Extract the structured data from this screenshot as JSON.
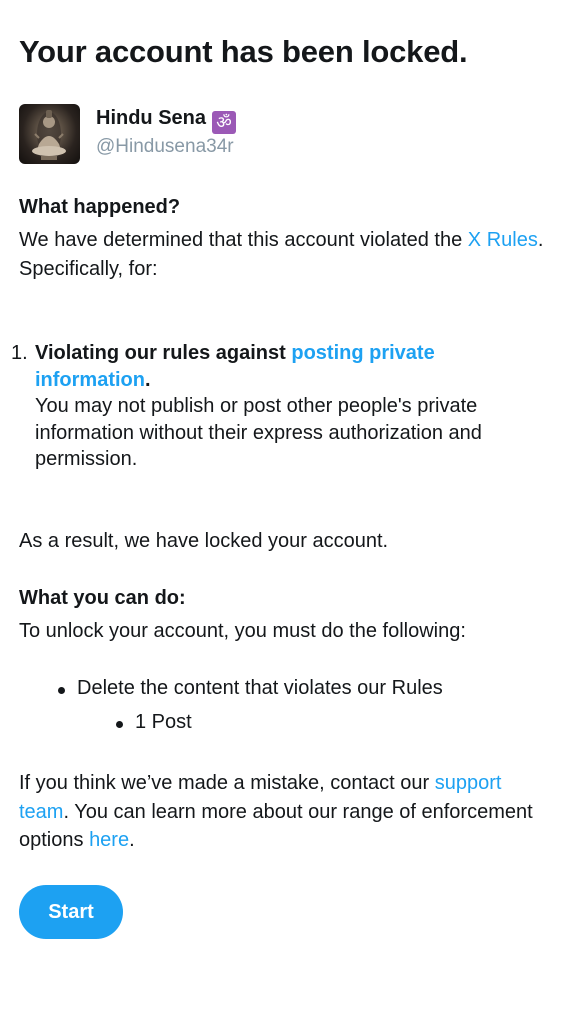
{
  "title": "Your account has been locked.",
  "account": {
    "display_name": "Hindu Sena",
    "badge_glyph": "ॐ",
    "handle": "@Hindusena34r"
  },
  "what_happened": {
    "heading": "What happened?",
    "text_before": "We have determined that this account violated the ",
    "rules_link": "X Rules",
    "text_after": ". Specifically, for:"
  },
  "violations": [
    {
      "number": "1.",
      "title_prefix": "Violating our rules against ",
      "title_link": "posting private information",
      "title_suffix": ".",
      "description": "You may not publish or post other people's private information without their express authorization and permission."
    }
  ],
  "result_text": "As a result, we have locked your account.",
  "what_you_can_do": {
    "heading": "What you can do:",
    "instructions": "To unlock your account, you must do the following:",
    "steps": [
      {
        "label": "Delete the content that violates our Rules",
        "sub": [
          "1 Post"
        ]
      }
    ]
  },
  "contact": {
    "text_before": "If you think we’ve made a mistake, contact our ",
    "support_link": "support team",
    "text_middle": ". You can learn more about our range of enforcement options ",
    "here_link": "here",
    "text_after": "."
  },
  "start_button": "Start",
  "colors": {
    "accent": "#1da1f2",
    "text": "#14171a",
    "muted": "#8899a6",
    "badge": "#9b59b6"
  }
}
